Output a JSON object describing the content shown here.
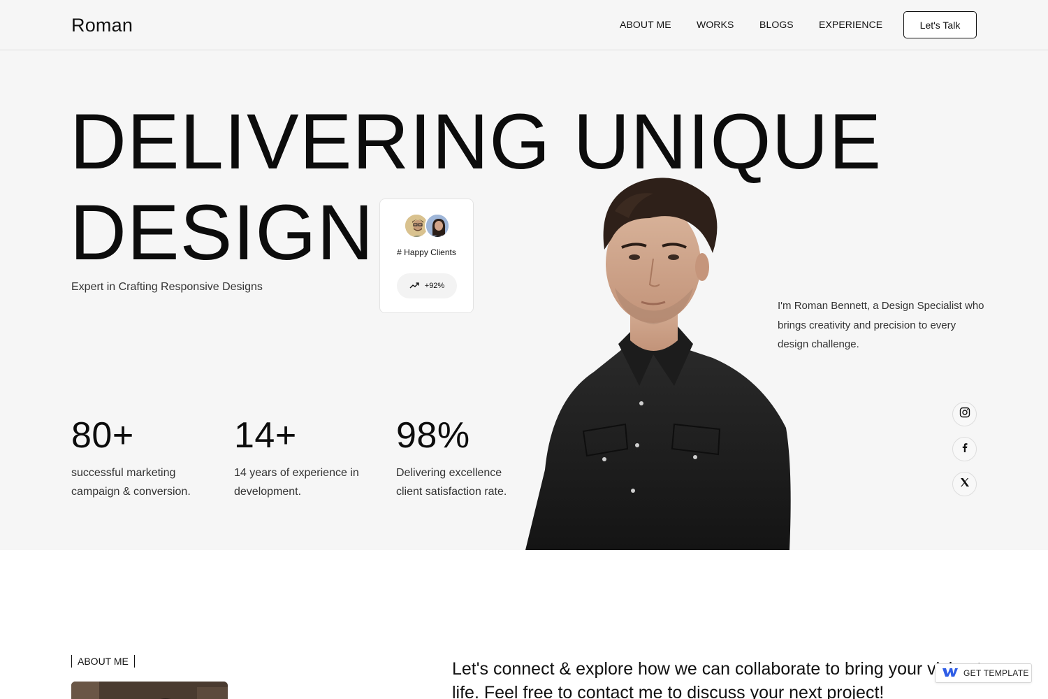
{
  "header": {
    "logo": "Roman",
    "nav": [
      "ABOUT ME",
      "WORKS",
      "BLOGS",
      "EXPERIENCE"
    ],
    "cta": "Let's Talk"
  },
  "hero": {
    "headline_line1": "DELIVERING UNIQUE",
    "headline_line2": "DESIGN",
    "subtitle": "Expert in Crafting Responsive Designs",
    "clients_card": {
      "label": "# Happy Clients",
      "growth": "+92%",
      "icon": "trending-up-icon"
    },
    "intro": "I'm Roman Bennett, a Design Specialist who brings creativity and precision to every design challenge.",
    "stats": [
      {
        "number": "80+",
        "description": "successful marketing campaign & conversion."
      },
      {
        "number": "14+",
        "description": "14 years of experience in development."
      },
      {
        "number": "98%",
        "description": "Delivering excellence client satisfaction rate."
      }
    ],
    "social": [
      "instagram-icon",
      "facebook-icon",
      "x-icon"
    ]
  },
  "about": {
    "tag": "ABOUT ME",
    "connect_text": "Let's connect & explore how we can collaborate to bring your vision to life. Feel free to contact me to discuss your next project!"
  },
  "badge": {
    "label": "GET TEMPLATE"
  },
  "colors": {
    "hero_bg": "#f6f6f6",
    "text": "#111111",
    "muted": "#333333"
  }
}
